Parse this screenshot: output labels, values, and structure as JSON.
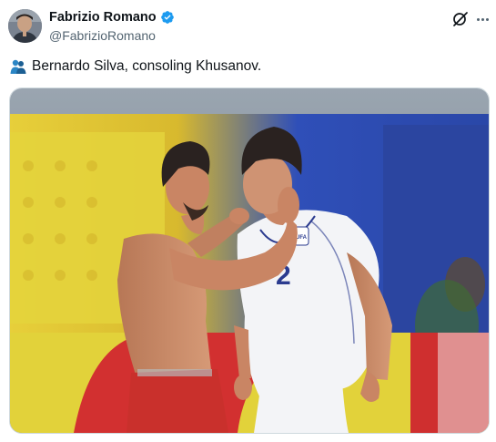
{
  "author": {
    "display_name": "Fabrizio Romano",
    "handle": "@FabrizioRomano",
    "verified_icon": "verified-badge-icon",
    "avatar_icon": "profile-avatar"
  },
  "actions": {
    "grok_icon": "grok-icon",
    "more_icon": "more-options-icon"
  },
  "tweet": {
    "emoji_icon": "people-hugging-emoji",
    "text": "Bernardo Silva, consoling Khusanov."
  },
  "media": {
    "type": "photo",
    "jersey_number": "2",
    "badge_text": "UFA"
  },
  "colors": {
    "verified_blue": "#1d9bf0",
    "text_primary": "#0f1419",
    "text_secondary": "#536471"
  }
}
